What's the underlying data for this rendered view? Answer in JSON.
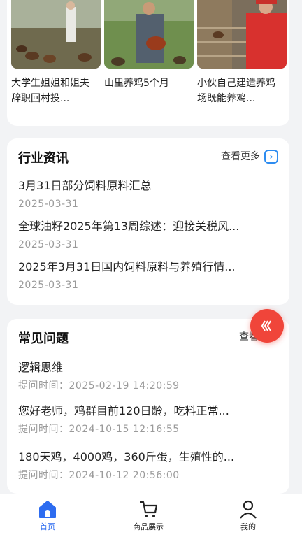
{
  "videos": [
    {
      "title": "大学生姐姐和姐夫辞职回村投..."
    },
    {
      "title": "山里养鸡5个月"
    },
    {
      "title": "小伙自己建造养鸡场既能养鸡..."
    }
  ],
  "news": {
    "title": "行业资讯",
    "more": "查看更多",
    "items": [
      {
        "title": "3月31日部分饲料原料汇总",
        "date": "2025-03-31"
      },
      {
        "title": "全球油籽2025年第13周综述：迎接关税风...",
        "date": "2025-03-31"
      },
      {
        "title": "2025年3月31日国内饲料原料与养殖行情...",
        "date": "2025-03-31"
      }
    ]
  },
  "faq": {
    "title": "常见问题",
    "more": "查看更多",
    "items": [
      {
        "title": "逻辑思维",
        "time": "提问时间：2025-02-19 14:20:59"
      },
      {
        "title": "您好老师，鸡群目前120日龄，吃料正常...",
        "time": "提问时间：2024-10-15 12:16:55"
      },
      {
        "title": "180天鸡，4000鸡，360斤蛋，生殖性的...",
        "time": "提问时间：2024-10-12 20:56:00"
      }
    ]
  },
  "tabbar": {
    "items": [
      {
        "label": "首页",
        "icon": "home-icon",
        "active": true
      },
      {
        "label": "商品展示",
        "icon": "cart-icon",
        "active": false
      },
      {
        "label": "我的",
        "icon": "user-icon",
        "active": false
      }
    ]
  },
  "colors": {
    "accent": "#2d6cf0",
    "fab": "#f0453a"
  }
}
